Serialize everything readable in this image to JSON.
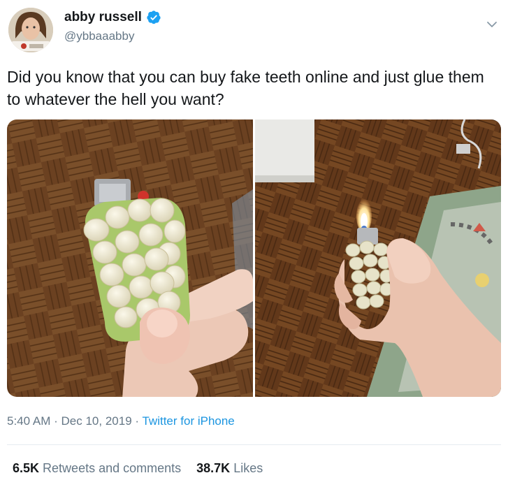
{
  "author": {
    "display_name": "abby russell",
    "handle": "@ybbaaabby",
    "verified": true
  },
  "tweet": {
    "text": "Did you know that you can buy fake teeth online and just glue them to whatever the hell you want?"
  },
  "meta": {
    "time": "5:40 AM",
    "separator": "·",
    "date": "Dec 10, 2019",
    "separator2": "·",
    "source": "Twitter for iPhone"
  },
  "stats": {
    "retweets_count": "6.5K",
    "retweets_label": "Retweets and comments",
    "likes_count": "38.7K",
    "likes_label": "Likes"
  },
  "colors": {
    "link": "#1b95e0",
    "secondary_text": "#657786",
    "verified_badge": "#1da1f2"
  },
  "icons": {
    "verified": "verified-badge-icon",
    "more": "chevron-down-icon"
  }
}
